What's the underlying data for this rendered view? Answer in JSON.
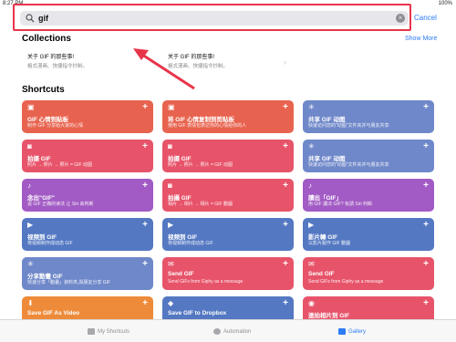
{
  "status_bar": {
    "time": "8:27 PM",
    "right": "100%"
  },
  "search": {
    "value": "gif",
    "cancel_label": "Cancel"
  },
  "collections": {
    "title": "Collections",
    "show_more": "Show More",
    "items": [
      {
        "title": "关于 GIF 的那些事!",
        "subtitle": "格式漫画、快捷指令抄制。"
      },
      {
        "title": "关于 GIF 的那些事!",
        "subtitle": "格式漫画、快捷指令抄制。"
      }
    ]
  },
  "shortcuts": {
    "title": "Shortcuts",
    "cards": [
      {
        "title": "GIF 心情到贴板",
        "subtitle": "制作 GIF 分享给大家的心情",
        "color": "#e8634f",
        "icon": "gif-icon"
      },
      {
        "title": "将 GIF 心情复制到剪贴板",
        "subtitle": "使用 GIF 表情包表达你的心情给你的人",
        "color": "#e8634f",
        "icon": "gif-icon"
      },
      {
        "title": "共享 GIF 动图",
        "subtitle": "快速访问您的\"动图\"文件夹并与朋友共享",
        "color": "#6f88c9",
        "icon": "sparkle-icon"
      },
      {
        "title": "拍摄 GIF",
        "subtitle": "照片 → 照片 → 照片 = GIF 动图",
        "color": "#e7546a",
        "icon": "camera-icon"
      },
      {
        "title": "拍摄 GIF",
        "subtitle": "照片 → 照片 → 照片 = GIF 动图",
        "color": "#e7546a",
        "icon": "camera-icon"
      },
      {
        "title": "共享 GIF 动图",
        "subtitle": "快速访问您的\"动图\"文件夹并与朋友共享",
        "color": "#6f88c9",
        "icon": "sparkle-icon"
      },
      {
        "title": "念出\"GIF\"",
        "subtitle": "说 GIF 正确的读法 让 Siri 来判断",
        "color": "#a25bc4",
        "icon": "mic-icon"
      },
      {
        "title": "拍攝 GIF",
        "subtitle": "相片 → 相片 → 相片 = GIF 動圖",
        "color": "#e7546a",
        "icon": "camera-icon"
      },
      {
        "title": "讀出「GIF」",
        "subtitle": "用 GIF 讀法 GIF? 有請 Siri 判斷",
        "color": "#a25bc4",
        "icon": "mic-icon"
      },
      {
        "title": "视频到 GIF",
        "subtitle": "将视频制作成动态 GIF",
        "color": "#5478c2",
        "icon": "video-icon"
      },
      {
        "title": "视频到 GIF",
        "subtitle": "将视频制作成动态 GIF",
        "color": "#5478c2",
        "icon": "video-icon"
      },
      {
        "title": "影片轉 GIF",
        "subtitle": "以影片製作 GIF 動圖",
        "color": "#5478c2",
        "icon": "video-icon"
      },
      {
        "title": "分享動畫 GIF",
        "subtitle": "快速分享「動畫」資料夾,與朋友分享 GIF",
        "color": "#6f88c9",
        "icon": "sparkle-icon"
      },
      {
        "title": "Send GIF",
        "subtitle": "Send GIFs from Giphy as a message",
        "color": "#e7546a",
        "icon": "message-icon"
      },
      {
        "title": "Send GIF",
        "subtitle": "Send GIFs from Giphy as a message",
        "color": "#e7546a",
        "icon": "message-icon"
      },
      {
        "title": "Save GIF As Video",
        "subtitle": "",
        "color": "#ee8b3a",
        "icon": "download-icon"
      },
      {
        "title": "Save GIF to Dropbox",
        "subtitle": "",
        "color": "#5478c2",
        "icon": "dropbox-icon"
      },
      {
        "title": "連拍相片到 GIF",
        "subtitle": "",
        "color": "#e7546a",
        "icon": "burst-icon"
      }
    ]
  },
  "tabbar": {
    "items": [
      {
        "label": "My Shortcuts",
        "active": false
      },
      {
        "label": "Automation",
        "active": false
      },
      {
        "label": "Gallery",
        "active": true
      }
    ]
  }
}
